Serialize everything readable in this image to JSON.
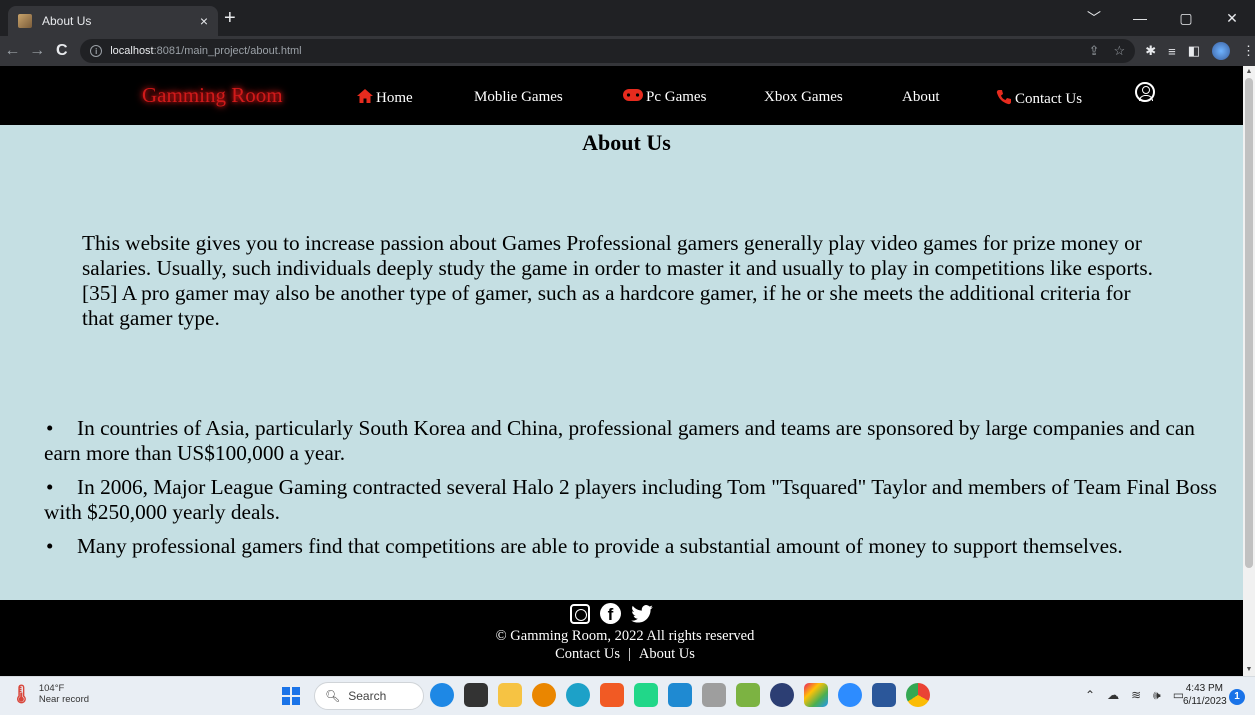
{
  "browser": {
    "tab_title": "About Us",
    "tab_close": "×",
    "new_tab": "+",
    "url_host": "localhost",
    "url_rest": ":8081/main_project/about.html"
  },
  "site": {
    "brand": "Gamming Room",
    "nav": [
      {
        "label": "Home",
        "icon": "home-icon"
      },
      {
        "label": "Moblie Games",
        "icon": ""
      },
      {
        "label": "Pc Games",
        "icon": "gamepad-icon"
      },
      {
        "label": "Xbox Games",
        "icon": ""
      },
      {
        "label": "About",
        "icon": ""
      },
      {
        "label": "Contact Us",
        "icon": "phone-icon"
      }
    ],
    "title": "About Us",
    "intro": "This website gives you to increase passion about Games Professional gamers generally play video games for prize money or salaries. Usually, such individuals deeply study the game in order to master it and usually to play in competitions like esports.[35] A pro gamer may also be another type of gamer, such as a hardcore gamer, if he or she meets the additional criteria for that gamer type.",
    "facts": [
      "In countries of Asia, particularly South Korea and China, professional gamers and teams are sponsored by large companies and can earn more than US$100,000 a year.",
      "In 2006, Major League Gaming contracted several Halo 2 players including Tom \"Tsquared\" Taylor and members of Team Final Boss with $250,000 yearly deals.",
      "Many professional gamers find that competitions are able to provide a substantial amount of money to support themselves."
    ],
    "footer": {
      "copyright": "© Gamming Room, 2022 All rights reserved",
      "link_contact": "Contact Us",
      "separator": "|",
      "link_about": "About Us"
    }
  },
  "taskbar": {
    "weather_temp": "104°F",
    "weather_desc": "Near record",
    "search_label": "Search",
    "time": "4:43 PM",
    "date": "6/11/2023",
    "notifications": "1"
  },
  "colors": {
    "page_bg": "#c5dfe3",
    "brand": "#d01a1a",
    "nav_bg": "#000000"
  }
}
